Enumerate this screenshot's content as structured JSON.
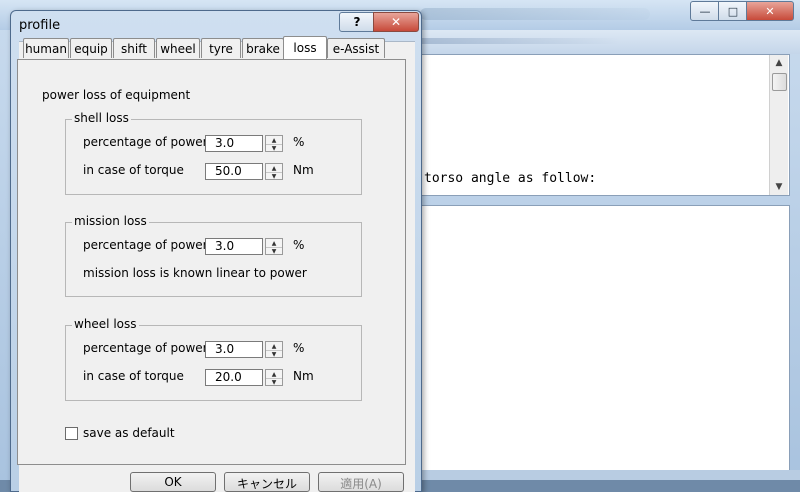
{
  "background_window": {
    "caption_buttons": {
      "minimize": "—",
      "maximize": "□",
      "close": "✕"
    },
    "text_area_line": "torso angle as follow:",
    "scroll_up": "▲",
    "scroll_down": "▼"
  },
  "dialog": {
    "title": "profile",
    "help_button": "?",
    "close_button": "✕",
    "tabs": [
      "human",
      "equip",
      "shift",
      "wheel",
      "tyre",
      "brake",
      "loss",
      "e-Assist"
    ],
    "active_tab": "loss",
    "heading": "power loss of equipment",
    "shell_loss": {
      "title": "shell loss",
      "power_label": "percentage of power",
      "power_value": "3.0",
      "power_unit": "%",
      "torque_label": "in case of torque",
      "torque_value": "50.0",
      "torque_unit": "Nm"
    },
    "mission_loss": {
      "title": "mission loss",
      "power_label": "percentage of power",
      "power_value": "3.0",
      "power_unit": "%",
      "note": "mission loss is known linear to power"
    },
    "wheel_loss": {
      "title": "wheel loss",
      "power_label": "percentage of power",
      "power_value": "3.0",
      "power_unit": "%",
      "torque_label": "in case of torque",
      "torque_value": "20.0",
      "torque_unit": "Nm"
    },
    "save_default_label": "save as default",
    "save_default_checked": false,
    "buttons": {
      "ok": "OK",
      "cancel": "キャンセル",
      "apply": "適用(A)"
    },
    "spin_up": "▲",
    "spin_down": "▼"
  }
}
